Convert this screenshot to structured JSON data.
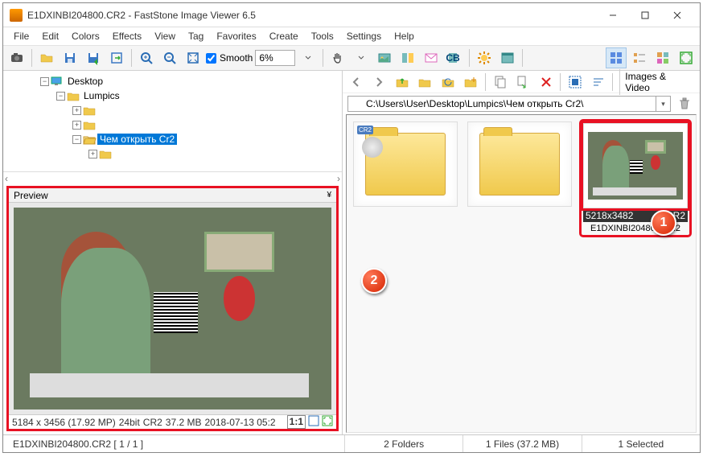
{
  "title": "E1DXINBI204800.CR2  -  FastStone Image Viewer 6.5",
  "menu": [
    "File",
    "Edit",
    "Colors",
    "Effects",
    "View",
    "Tag",
    "Favorites",
    "Create",
    "Tools",
    "Settings",
    "Help"
  ],
  "smooth_label": "Smooth",
  "zoom_value": "6%",
  "tree": {
    "desktop": "Desktop",
    "lumpics": "Lumpics",
    "selected": "Чем открыть Cr2"
  },
  "preview": {
    "header": "Preview",
    "status": {
      "dims": "5184 x 3456 (17.92 MP)",
      "bits": "24bit",
      "fmt": "CR2",
      "size": "37.2 MB",
      "date": "2018-07-13 05:2",
      "ratio": "1:1"
    }
  },
  "address": "C:\\Users\\User\\Desktop\\Lumpics\\Чем открыть Cr2\\",
  "nav_filter": "Images & Video",
  "thumb": {
    "dims": "5218x3482",
    "fmt": "CR2",
    "name": "E1DXINBI204800.CR2"
  },
  "status": {
    "left": "E1DXINBI204800.CR2 [ 1 / 1 ]",
    "folders": "2 Folders",
    "files": "1 Files (37.2 MB)",
    "selected": "1 Selected"
  },
  "annot": {
    "one": "1",
    "two": "2"
  }
}
